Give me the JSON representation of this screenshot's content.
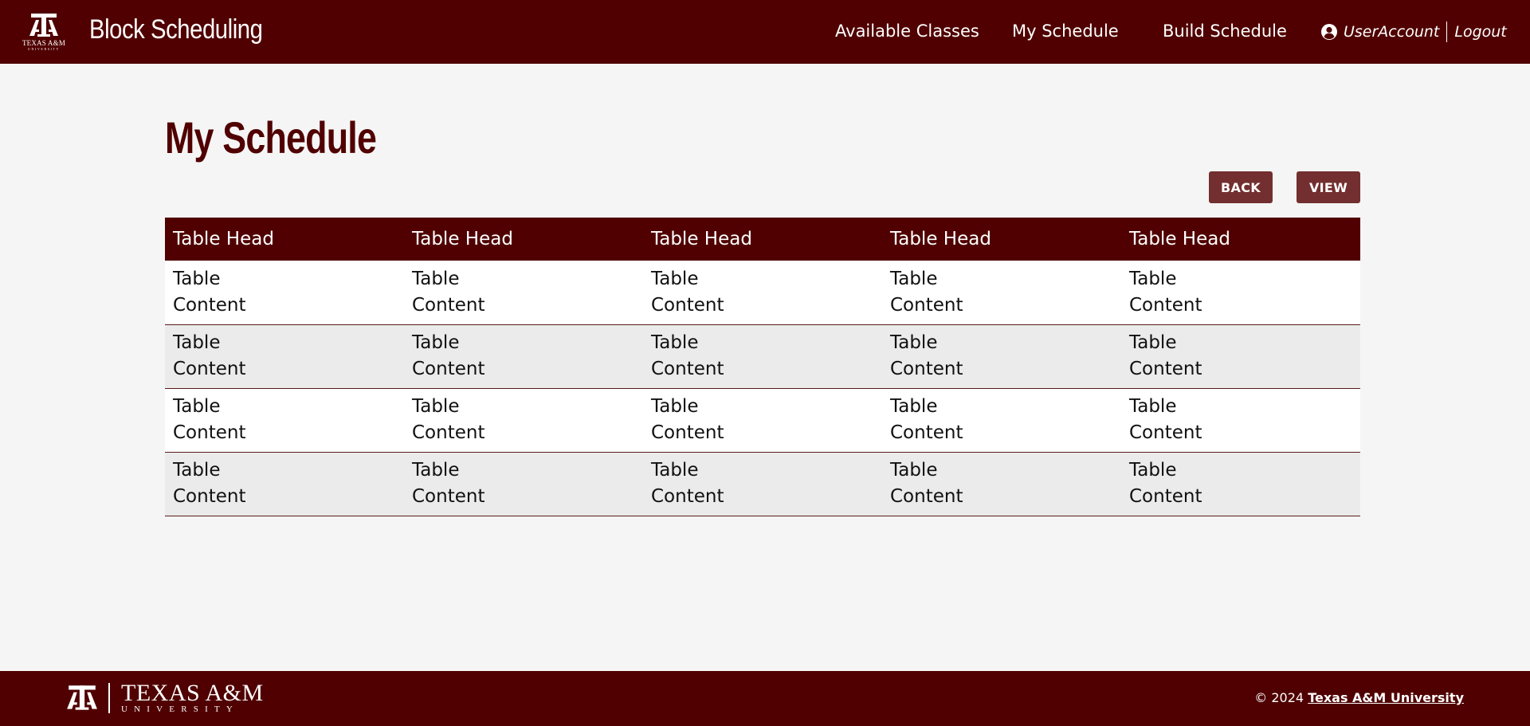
{
  "header": {
    "logo_text": "TEXAS A&M",
    "logo_subtext": "UNIVERSITY",
    "app_title": "Block Scheduling",
    "nav": {
      "available_classes": "Available Classes",
      "my_schedule": "My Schedule",
      "build_schedule": "Build Schedule"
    },
    "account": {
      "user_label": "UserAccount",
      "logout_label": "Logout"
    }
  },
  "main": {
    "page_title": "My Schedule",
    "buttons": {
      "back": "BACK",
      "view": "VIEW"
    },
    "table": {
      "headers": [
        "Table Head",
        "Table Head",
        "Table Head",
        "Table Head",
        "Table Head"
      ],
      "rows": [
        [
          "Table Content",
          "Table Content",
          "Table Content",
          "Table Content",
          "Table Content"
        ],
        [
          "Table Content",
          "Table Content",
          "Table Content",
          "Table Content",
          "Table Content"
        ],
        [
          "Table Content",
          "Table Content",
          "Table Content",
          "Table Content",
          "Table Content"
        ],
        [
          "Table Content",
          "Table Content",
          "Table Content",
          "Table Content",
          "Table Content"
        ]
      ]
    }
  },
  "footer": {
    "brand_main": "TEXAS A&M",
    "brand_sub": "UNIVERSITY",
    "copyright_prefix": "© 2024",
    "copyright_link": "Texas A&M University"
  },
  "colors": {
    "brand_maroon": "#500000",
    "button_maroon": "#732f2f",
    "page_background": "#f5f5f5",
    "row_alt": "#ebebeb"
  },
  "icons": {
    "logo": "atm-logo-icon",
    "user": "user-circle-icon"
  }
}
